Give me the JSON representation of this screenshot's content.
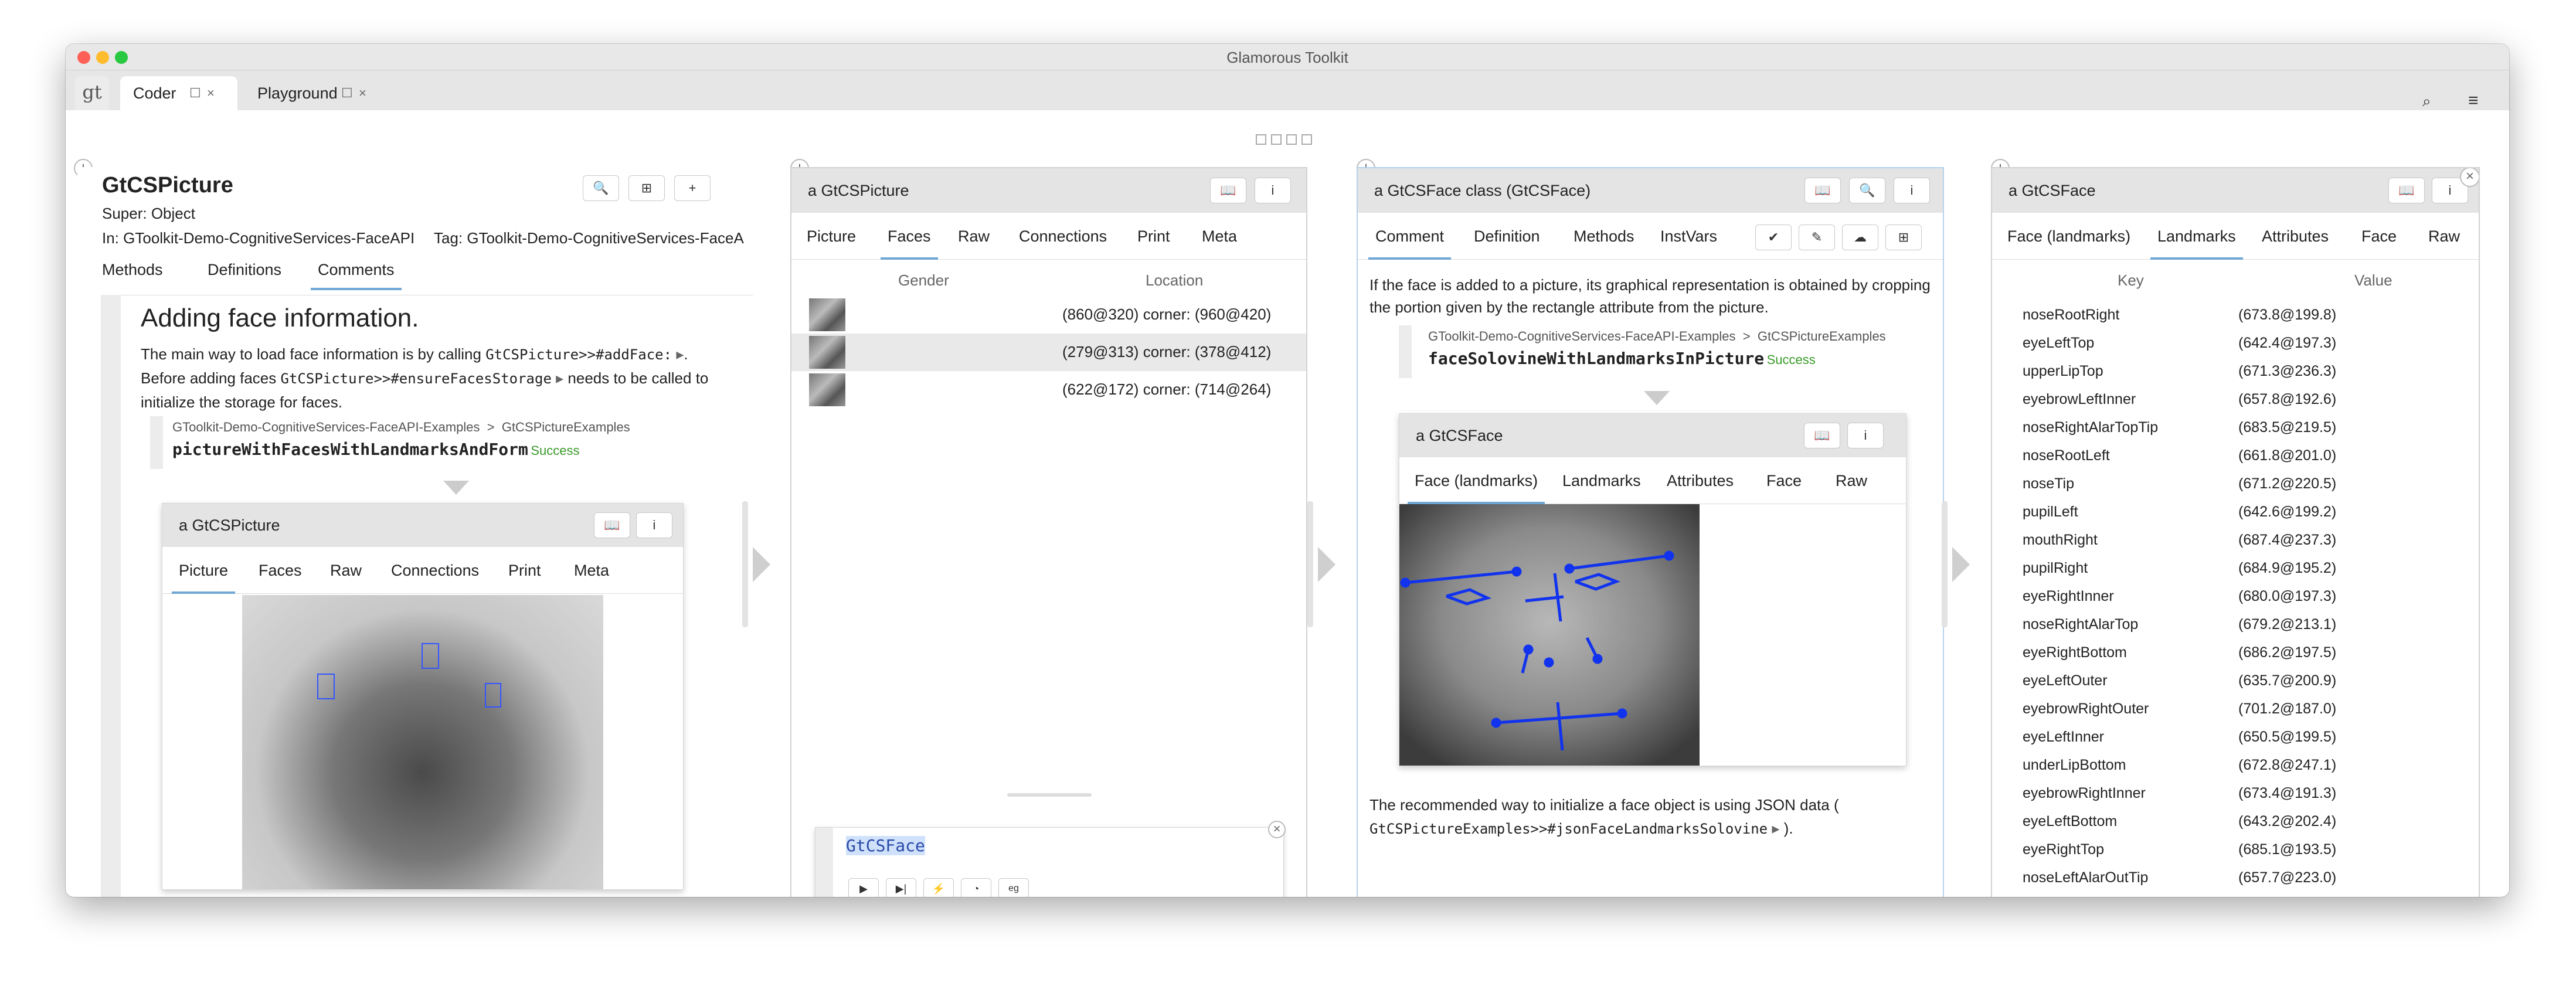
{
  "window": {
    "title": "Glamorous Toolkit"
  },
  "tabs": [
    {
      "label": "Coder"
    },
    {
      "label": "Playground"
    }
  ],
  "logo": "gt",
  "toolbar": {
    "search_icon": "search-icon",
    "menu_icon": "hamburger-menu-icon"
  },
  "pane1": {
    "class_name": "GtCSPicture",
    "super": "Super: Object",
    "package": "In: GToolkit-Demo-CognitiveServices-FaceAPI",
    "tag": "Tag: GToolkit-Demo-CognitiveServices-FaceA",
    "tabs": [
      "Methods",
      "Definitions",
      "Comments"
    ],
    "heading": "Adding face information.",
    "p1a": "The main way to load face information is by calling",
    "p1code": "GtCSPicture>>#addFace:",
    "p1b": ". Before adding faces",
    "p1code2": "GtCSPicture>>#ensureFacesStorage",
    "p1c": "needs to be called to initialize the storage for faces.",
    "ex_pkg": "GToolkit-Demo-CognitiveServices-FaceAPI-Examples",
    "ex_sep": ">",
    "ex_cls": "GtCSPictureExamples",
    "ex_method": "pictureWithFacesWithLandmarksAndForm",
    "ex_status": "Success",
    "inner_title": "a GtCSPicture",
    "inner_tabs": [
      "Picture",
      "Faces",
      "Raw",
      "Connections",
      "Print",
      "Meta"
    ]
  },
  "pane2": {
    "title": "a GtCSPicture",
    "tabs": [
      "Picture",
      "Faces",
      "Raw",
      "Connections",
      "Print",
      "Meta"
    ],
    "col_gender": "Gender",
    "col_location": "Location",
    "rows": [
      "(860@320) corner: (960@420)",
      "(279@313) corner: (378@412)",
      "(622@172) corner: (714@264)"
    ],
    "playground_code": "GtCSFace",
    "playground_eg": "eg"
  },
  "pane3": {
    "title": "a GtCSFace class (GtCSFace)",
    "tabs": [
      "Comment",
      "Definition",
      "Methods",
      "InstVars"
    ],
    "p1": "If the face is added to a picture, its graphical representation is obtained by cropping the portion given by the rectangle attribute from the picture.",
    "ex_pkg": "GToolkit-Demo-CognitiveServices-FaceAPI-Examples",
    "ex_sep": ">",
    "ex_cls": "GtCSPictureExamples",
    "ex_method": "faceSolovineWithLandmarksInPicture",
    "ex_status": "Success",
    "inner_title": "a GtCSFace",
    "inner_tabs": [
      "Face (landmarks)",
      "Landmarks",
      "Attributes",
      "Face",
      "Raw"
    ],
    "p2a": "The recommended way to initialize a face object is using JSON data (",
    "p2code": "GtCSPictureExamples>>#jsonFaceLandmarksSolovine",
    "p2b": ")."
  },
  "pane4": {
    "title": "a GtCSFace",
    "tabs": [
      "Face (landmarks)",
      "Landmarks",
      "Attributes",
      "Face",
      "Raw"
    ],
    "col_key": "Key",
    "col_value": "Value",
    "rows": [
      [
        "noseRootRight",
        "(673.8@199.8)"
      ],
      [
        "eyeLeftTop",
        "(642.4@197.3)"
      ],
      [
        "upperLipTop",
        "(671.3@236.3)"
      ],
      [
        "eyebrowLeftInner",
        "(657.8@192.6)"
      ],
      [
        "noseRightAlarTopTip",
        "(683.5@219.5)"
      ],
      [
        "noseRootLeft",
        "(661.8@201.0)"
      ],
      [
        "noseTip",
        "(671.2@220.5)"
      ],
      [
        "pupilLeft",
        "(642.6@199.2)"
      ],
      [
        "mouthRight",
        "(687.4@237.3)"
      ],
      [
        "pupilRight",
        "(684.9@195.2)"
      ],
      [
        "eyeRightInner",
        "(680.0@197.3)"
      ],
      [
        "noseRightAlarTop",
        "(679.2@213.1)"
      ],
      [
        "eyeRightBottom",
        "(686.2@197.5)"
      ],
      [
        "eyeLeftOuter",
        "(635.7@200.9)"
      ],
      [
        "eyebrowRightOuter",
        "(701.2@187.0)"
      ],
      [
        "eyeLeftInner",
        "(650.5@199.5)"
      ],
      [
        "underLipBottom",
        "(672.8@247.1)"
      ],
      [
        "eyebrowRightInner",
        "(673.4@191.3)"
      ],
      [
        "eyeLeftBottom",
        "(643.2@202.4)"
      ],
      [
        "eyeRightTop",
        "(685.1@193.5)"
      ],
      [
        "noseLeftAlarOutTip",
        "(657.7@223.0)"
      ]
    ]
  }
}
